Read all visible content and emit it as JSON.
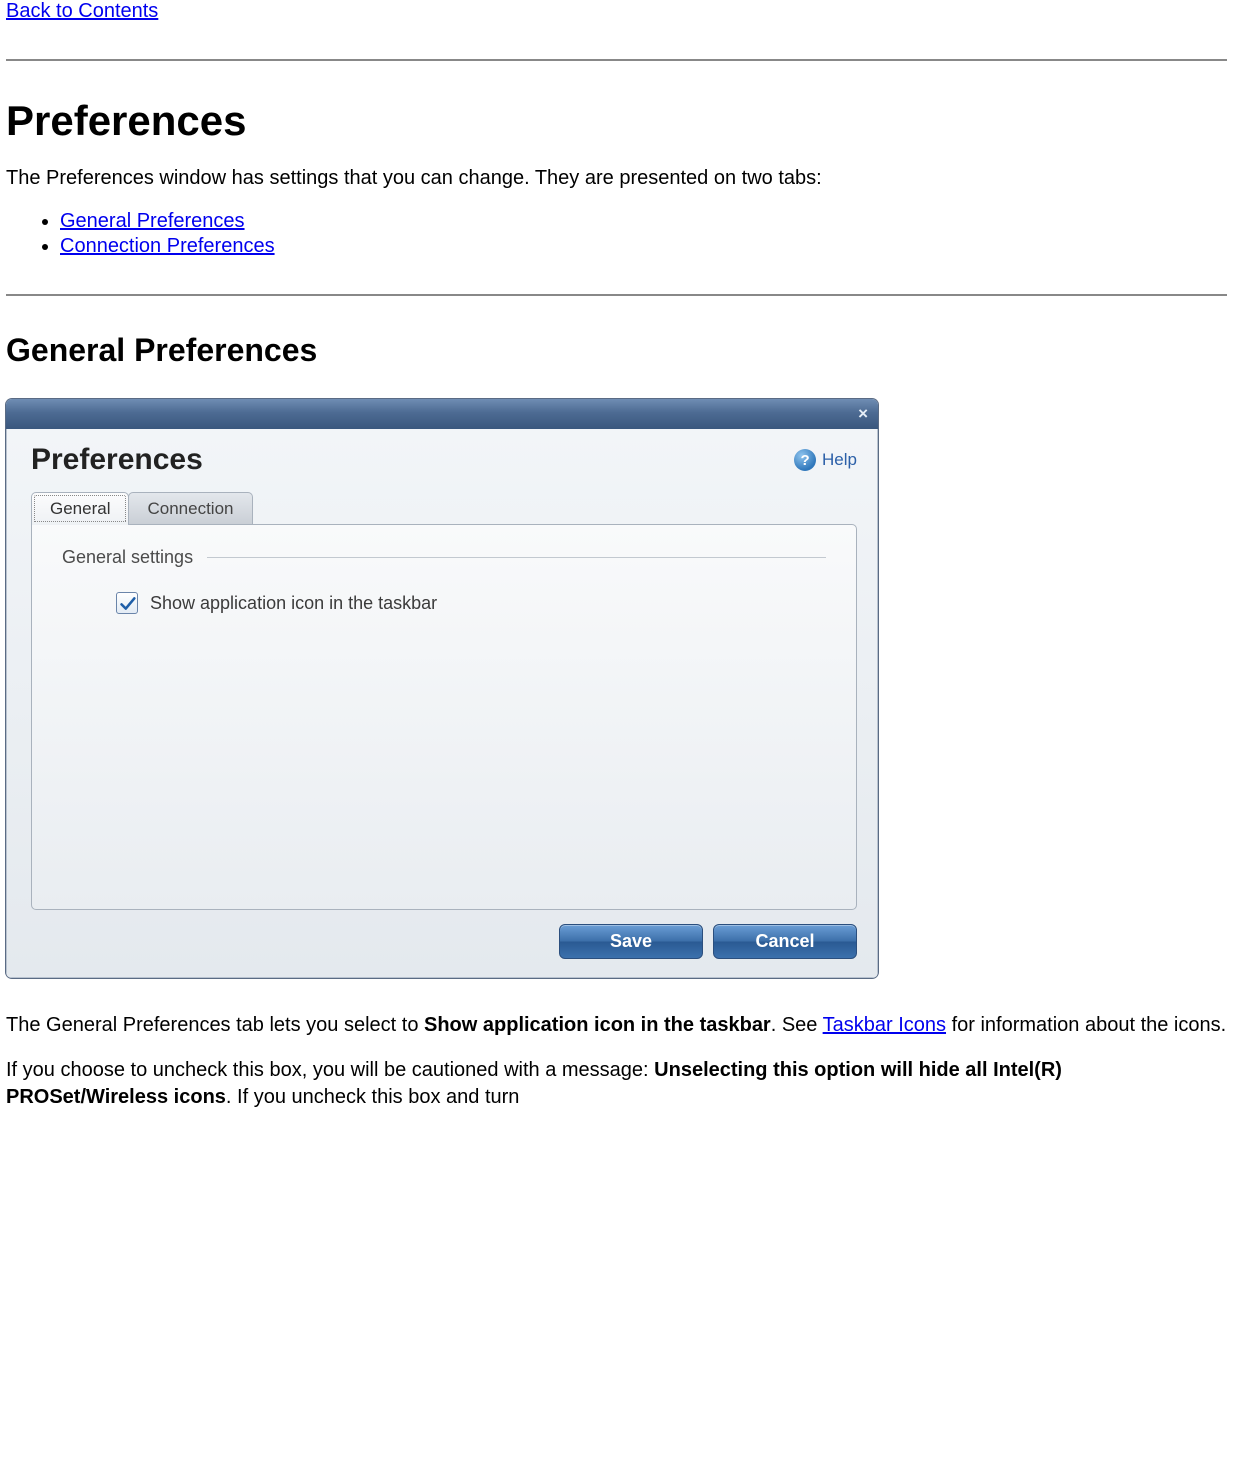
{
  "nav": {
    "back_link": "Back to Contents"
  },
  "heading_main": "Preferences",
  "intro_text": "The Preferences window has settings that you can change. They are presented on two tabs:",
  "links": {
    "general": "General Preferences ",
    "connection": "Connection Preferences "
  },
  "heading_general": "General Preferences",
  "dialog": {
    "title": "Preferences",
    "close_glyph": "×",
    "help_label": "Help",
    "help_glyph": "?",
    "tabs": {
      "general": "General",
      "connection": "Connection"
    },
    "fieldset_label": "General settings",
    "checkbox_label": "Show application icon in the taskbar",
    "checkbox_checked": true,
    "buttons": {
      "save": "Save",
      "cancel": "Cancel"
    }
  },
  "para_after": {
    "p1_a": "The General Preferences tab lets you select to ",
    "p1_bold": "Show application icon in the taskbar",
    "p1_b": ". See ",
    "taskbar_link": "Taskbar Icons",
    "p1_c": " for information about the icons.",
    "p2_a": "If you choose to uncheck this box, you will be cautioned with a message: ",
    "p2_bold": "Unselecting this option will hide all Intel(R) PROSet/Wireless icons",
    "p2_b": ". If you uncheck this box and turn"
  }
}
